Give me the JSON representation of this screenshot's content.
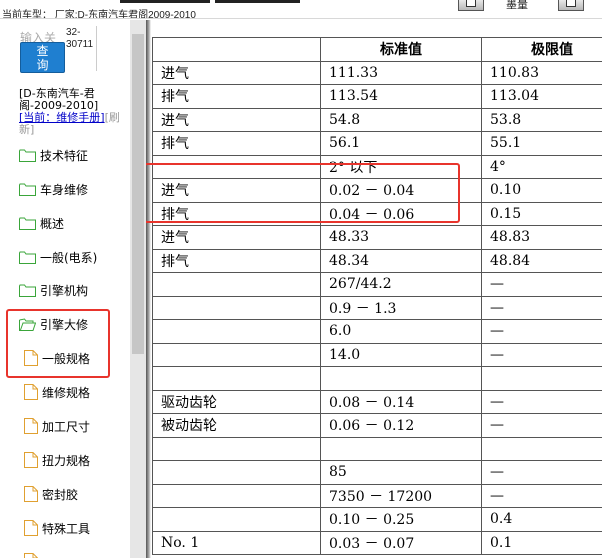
{
  "topbar": {
    "model_text": "当前车型：  厂家:D-东南汽车君阁2009-2010",
    "right_label": "墨量"
  },
  "sidebar": {
    "search_label": "输入关",
    "search_code_1": "32-",
    "search_code_2": "30711",
    "search_button": "查\n询",
    "model_info": "[D-东南汽车-君阁-2009-2010]",
    "current_label": "[当前：维修手册]",
    "refresh_label": "[刷新]",
    "items": [
      {
        "label": "技术特征",
        "icon": "folder-icon"
      },
      {
        "label": "车身维修",
        "icon": "folder-icon"
      },
      {
        "label": "概述",
        "icon": "folder-icon"
      },
      {
        "label": "一般(电系)",
        "icon": "folder-icon"
      },
      {
        "label": "引擎机构",
        "icon": "folder-icon"
      },
      {
        "label": "引擎大修",
        "icon": "folder-open-icon"
      },
      {
        "label": "一般规格",
        "icon": "document-icon"
      },
      {
        "label": "维修规格",
        "icon": "document-icon"
      },
      {
        "label": "加工尺寸",
        "icon": "document-icon"
      },
      {
        "label": "扭力规格",
        "icon": "document-icon"
      },
      {
        "label": "密封胶",
        "icon": "document-icon"
      },
      {
        "label": "特殊工具",
        "icon": "document-icon"
      },
      {
        "label": "",
        "icon": "document-icon"
      }
    ]
  },
  "table": {
    "headers": [
      "",
      "标准值",
      "极限值"
    ],
    "rows": [
      [
        "进气",
        "111.33",
        "110.83"
      ],
      [
        "排气",
        "113.54",
        "113.04"
      ],
      [
        "进气",
        "54.8",
        "53.8"
      ],
      [
        "排气",
        "56.1",
        "55.1"
      ],
      [
        "",
        "2° 以下",
        "4°"
      ],
      [
        "进气",
        "0.02 － 0.04",
        "0.10"
      ],
      [
        "排气",
        "0.04 － 0.06",
        "0.15"
      ],
      [
        "进气",
        "48.33",
        "48.83"
      ],
      [
        "排气",
        "48.34",
        "48.84"
      ],
      [
        "",
        "267/44.2",
        "—"
      ],
      [
        "",
        "0.9 － 1.3",
        "—"
      ],
      [
        "",
        "6.0",
        "—"
      ],
      [
        "",
        "14.0",
        "—"
      ],
      [
        "",
        "",
        ""
      ],
      [
        "驱动齿轮",
        "0.08 － 0.14",
        "—"
      ],
      [
        "被动齿轮",
        "0.06 － 0.12",
        "—"
      ],
      [
        "",
        "",
        ""
      ],
      [
        "",
        "85",
        "—"
      ],
      [
        "",
        "7350 － 17200",
        "—"
      ],
      [
        "",
        "0.10 － 0.25",
        "0.4"
      ],
      [
        "No. 1",
        "0.03 － 0.07",
        "0.1"
      ]
    ]
  },
  "colors": {
    "highlight": "#e8342c",
    "button": "#1f7fd0",
    "folder": "#3aa53a",
    "document": "#e0a030"
  }
}
